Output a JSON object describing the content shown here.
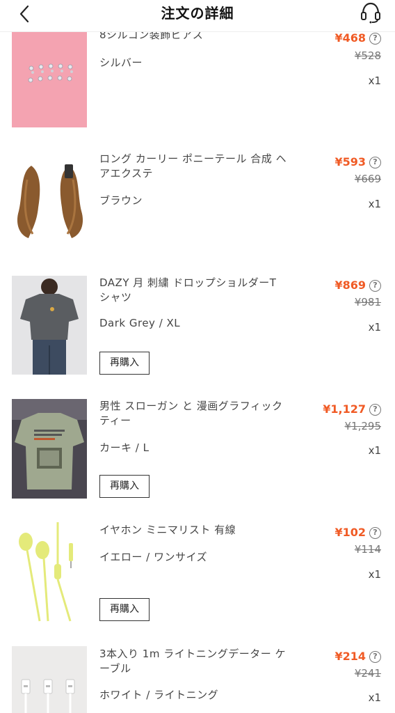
{
  "header": {
    "title": "注文の詳細",
    "back_icon": "chevron-left-icon",
    "support_icon": "headset-icon"
  },
  "colors": {
    "price": "#f05a24",
    "text": "#444444",
    "border": "#333333"
  },
  "items": [
    {
      "name": "8シルコン装飾ピアス",
      "variant": "シルバー",
      "price": "¥468",
      "original_price": "¥528",
      "qty": "x1",
      "rebuy": ""
    },
    {
      "name": "ロング カーリー ポニーテール 合成 ヘアエクステ",
      "variant": "ブラウン",
      "price": "¥593",
      "original_price": "¥669",
      "qty": "x1",
      "rebuy": ""
    },
    {
      "name": "DAZY 月 刺繍 ドロップショルダーT シャツ",
      "variant": "Dark Grey / XL",
      "price": "¥869",
      "original_price": "¥981",
      "qty": "x1",
      "rebuy": "再購入"
    },
    {
      "name": "男性 スローガン と 漫画グラフィック ティー",
      "variant": "カーキ / L",
      "price": "¥1,127",
      "original_price": "¥1,295",
      "qty": "x1",
      "rebuy": "再購入"
    },
    {
      "name": "イヤホン ミニマリスト 有線",
      "variant": "イエロー / ワンサイズ",
      "price": "¥102",
      "original_price": "¥114",
      "qty": "x1",
      "rebuy": "再購入"
    },
    {
      "name": "3本入り 1m ライトニングデーター ケーブル",
      "variant": "ホワイト / ライトニング",
      "price": "¥214",
      "original_price": "¥241",
      "qty": "x1",
      "rebuy": ""
    }
  ]
}
